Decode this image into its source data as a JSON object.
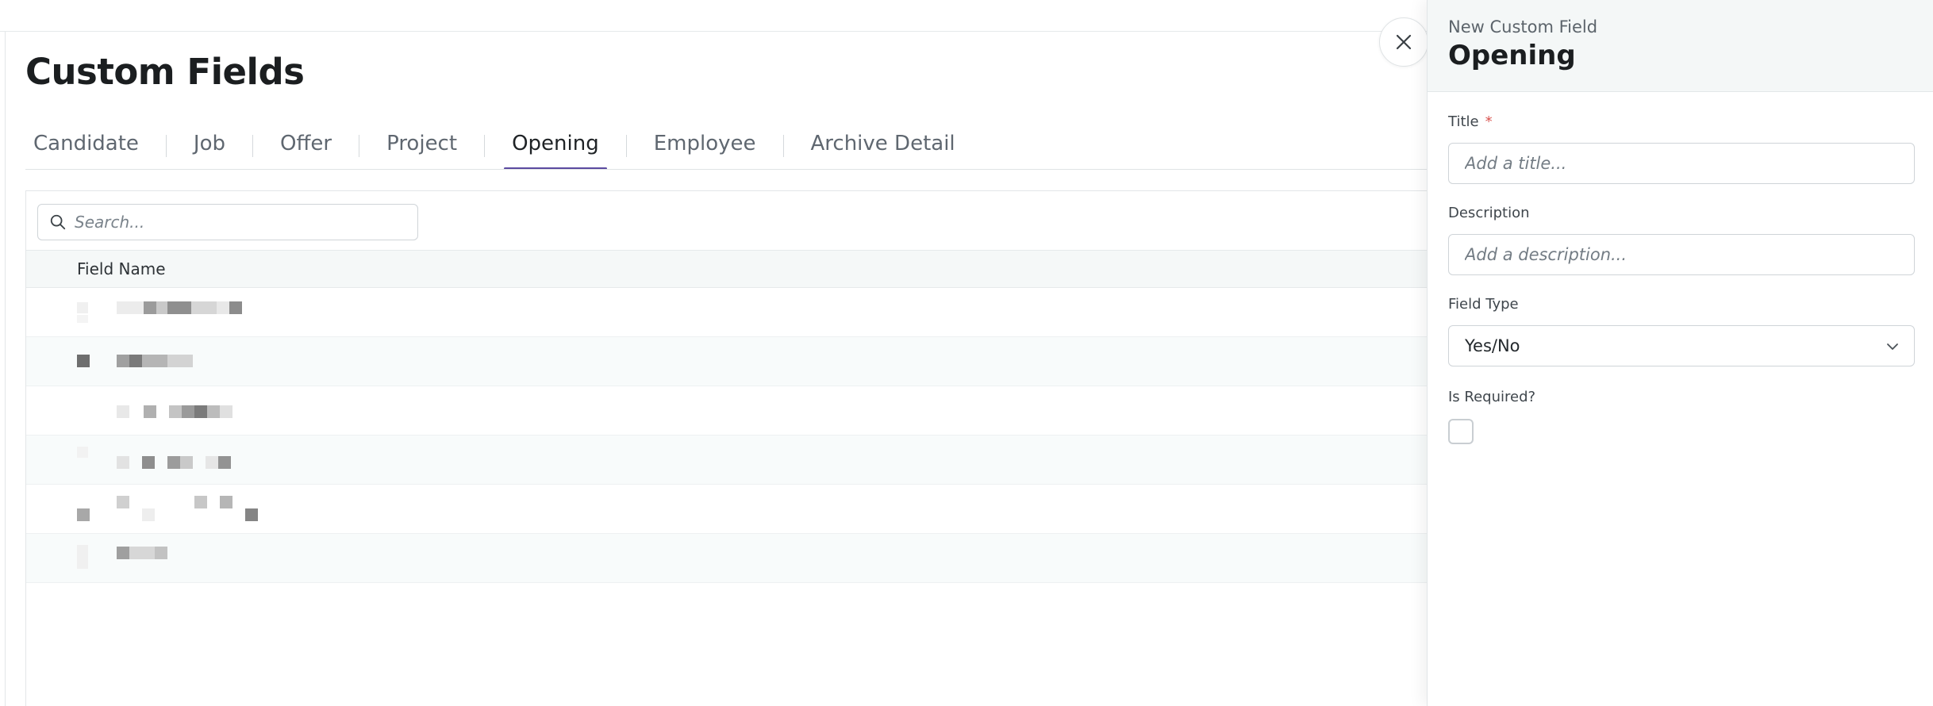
{
  "page": {
    "title": "Custom Fields"
  },
  "tabs": [
    {
      "label": "Candidate",
      "active": false
    },
    {
      "label": "Job",
      "active": false
    },
    {
      "label": "Offer",
      "active": false
    },
    {
      "label": "Project",
      "active": false
    },
    {
      "label": "Opening",
      "active": true
    },
    {
      "label": "Employee",
      "active": false
    },
    {
      "label": "Archive Detail",
      "active": false
    }
  ],
  "table": {
    "search_placeholder": "Search...",
    "column_header": "Field Name",
    "rows": [
      "",
      "",
      "",
      "",
      "",
      ""
    ],
    "redacted": true
  },
  "drawer": {
    "subtitle": "New Custom Field",
    "title": "Opening",
    "title_field": {
      "label": "Title",
      "required_mark": "*",
      "placeholder": "Add a title...",
      "value": ""
    },
    "description_field": {
      "label": "Description",
      "placeholder": "Add a description...",
      "value": ""
    },
    "field_type": {
      "label": "Field Type",
      "value": "Yes/No"
    },
    "is_required": {
      "label": "Is Required?",
      "checked": false
    }
  },
  "icons": {
    "search": "search-icon",
    "close": "close-icon",
    "chevron": "chevron-down-icon"
  },
  "colors": {
    "accent": "#5b4aa0",
    "required": "#d9534f",
    "header_bg": "#f4f7f7"
  }
}
